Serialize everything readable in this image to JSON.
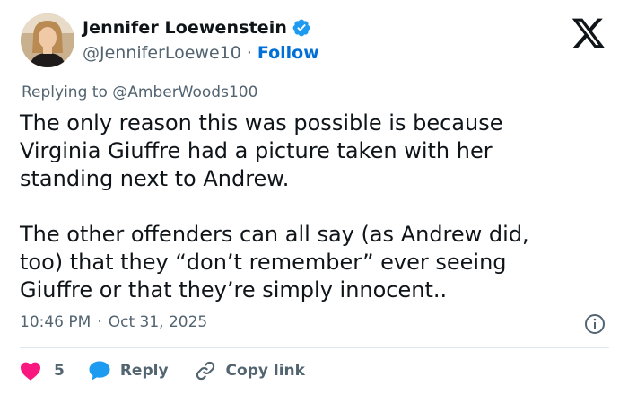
{
  "author": {
    "name": "Jennifer Loewenstein",
    "handle": "@JenniferLoewe10",
    "separator": "·",
    "follow_label": "Follow",
    "verified": true,
    "avatar_icon": "profile-photo"
  },
  "reply_to": {
    "prefix": "Replying to",
    "mention": "@AmberWoods100"
  },
  "tweet": {
    "text": "The only reason this was possible is because\nVirginia Giuffre had a picture taken with her\nstanding next to Andrew.\n\nThe other offenders can all say (as Andrew did,\ntoo) that they “don’t remember” ever seeing\nGiuffre or that they’re simply innocent.."
  },
  "meta": {
    "time": "10:46 PM",
    "separator": "·",
    "date": "Oct 31, 2025"
  },
  "actions": {
    "like_count": "5",
    "reply_label": "Reply",
    "copy_label": "Copy link"
  },
  "colors": {
    "text": "#0f1419",
    "muted": "#536471",
    "link": "#006fd6",
    "verified": "#1d9bf0",
    "like": "#f91880",
    "reply": "#1d9bf0"
  },
  "icons": [
    "verified-badge-icon",
    "x-logo-icon",
    "info-icon",
    "heart-icon",
    "speech-bubble-icon",
    "link-icon"
  ]
}
